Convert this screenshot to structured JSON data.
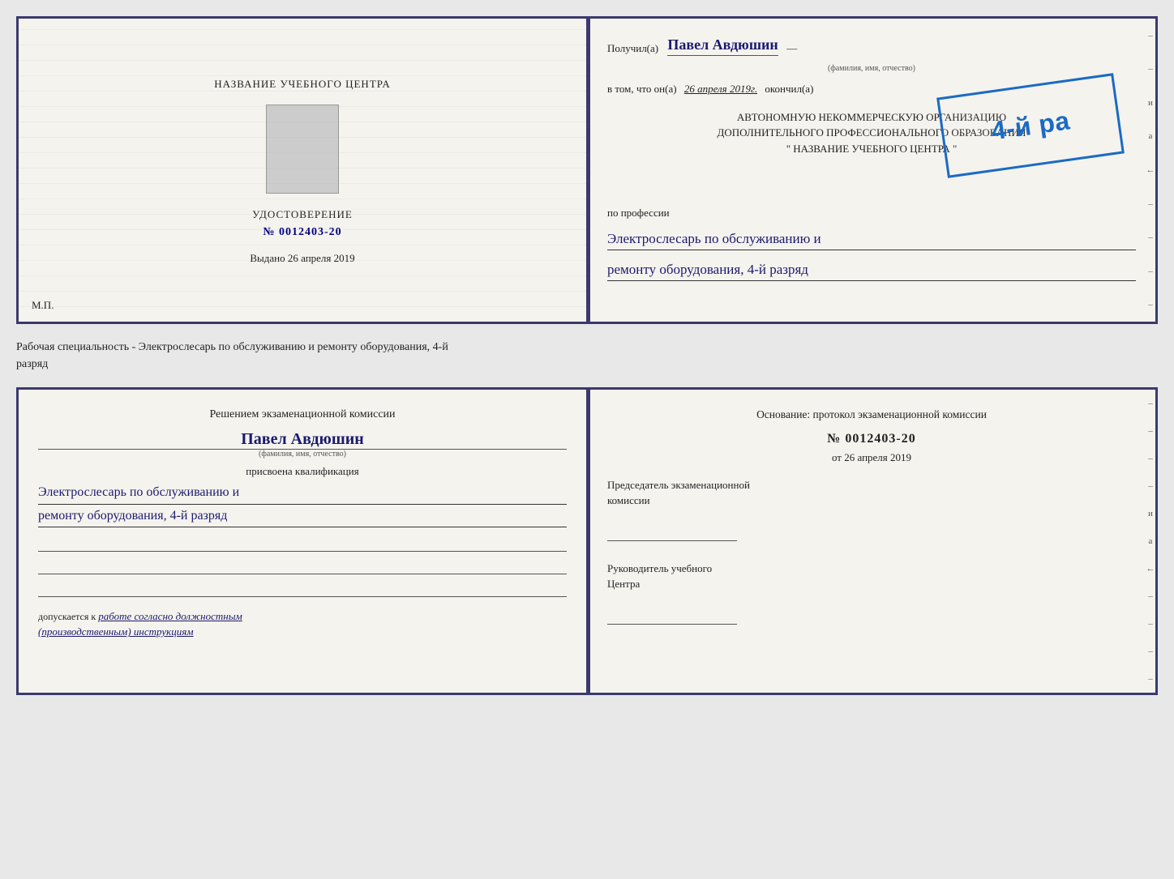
{
  "topDoc": {
    "left": {
      "centerTitle": "НАЗВАНИЕ УЧЕБНОГО ЦЕНТРА",
      "certLabel": "УДОСТОВЕРЕНИЕ",
      "certNumber": "№ 0012403-20",
      "issuedLabel": "Выдано",
      "issuedDate": "26 апреля 2019",
      "mpLabel": "М.П."
    },
    "right": {
      "recipientPrefix": "Получил(а)",
      "recipientName": "Павел Авдюшин",
      "fioLabel": "(фамилия, имя, отчество)",
      "inThatPrefix": "в том, что он(а)",
      "date": "26 апреля 2019г.",
      "finishedLabel": "окончил(а)",
      "stampLine1": "4-й ра",
      "orgLine1": "АВТОНОМНУЮ НЕКОММЕРЧЕСКУЮ ОРГАНИЗАЦИЮ",
      "orgLine2": "ДОПОЛНИТЕЛЬНОГО ПРОФЕССИОНАЛЬНОГО ОБРАЗОВАНИЯ",
      "orgLine3": "\" НАЗВАНИЕ УЧЕБНОГО ЦЕНТРА \"",
      "professionLabel": "по профессии",
      "professionLine1": "Электрослесарь по обслуживанию и",
      "professionLine2": "ремонту оборудования, 4-й разряд",
      "dashItems": [
        "–",
        "–",
        "и",
        "а",
        "←",
        "–",
        "–",
        "–",
        "–"
      ]
    }
  },
  "middleText": "Рабочая специальность - Электрослесарь по обслуживанию и ремонту оборудования, 4-й\nразряд",
  "bottomDoc": {
    "left": {
      "titleLine1": "Решением экзаменационной комиссии",
      "personName": "Павел Авдюшин",
      "fioLabel": "(фамилия, имя, отчество)",
      "qualLabel": "присвоена квалификация",
      "qualLine1": "Электрослесарь по обслуживанию и",
      "qualLine2": "ремонту оборудования, 4-й разряд",
      "допускаетсяPrefix": "допускается к",
      "допускаетсяText": "работе согласно должностным\n(производственным) инструкциям"
    },
    "right": {
      "osnovLabel": "Основание: протокол экзаменационной комиссии",
      "protocolNumber": "№  0012403-20",
      "otPrefix": "от",
      "otDate": "26 апреля 2019",
      "chairmanLabel": "Председатель экзаменационной\nкомиссии",
      "руководительLabel": "Руководитель учебного\nЦентра",
      "dashItems": [
        "–",
        "–",
        "–",
        "–",
        "и",
        "а",
        "←",
        "–",
        "–",
        "–",
        "–"
      ]
    }
  }
}
